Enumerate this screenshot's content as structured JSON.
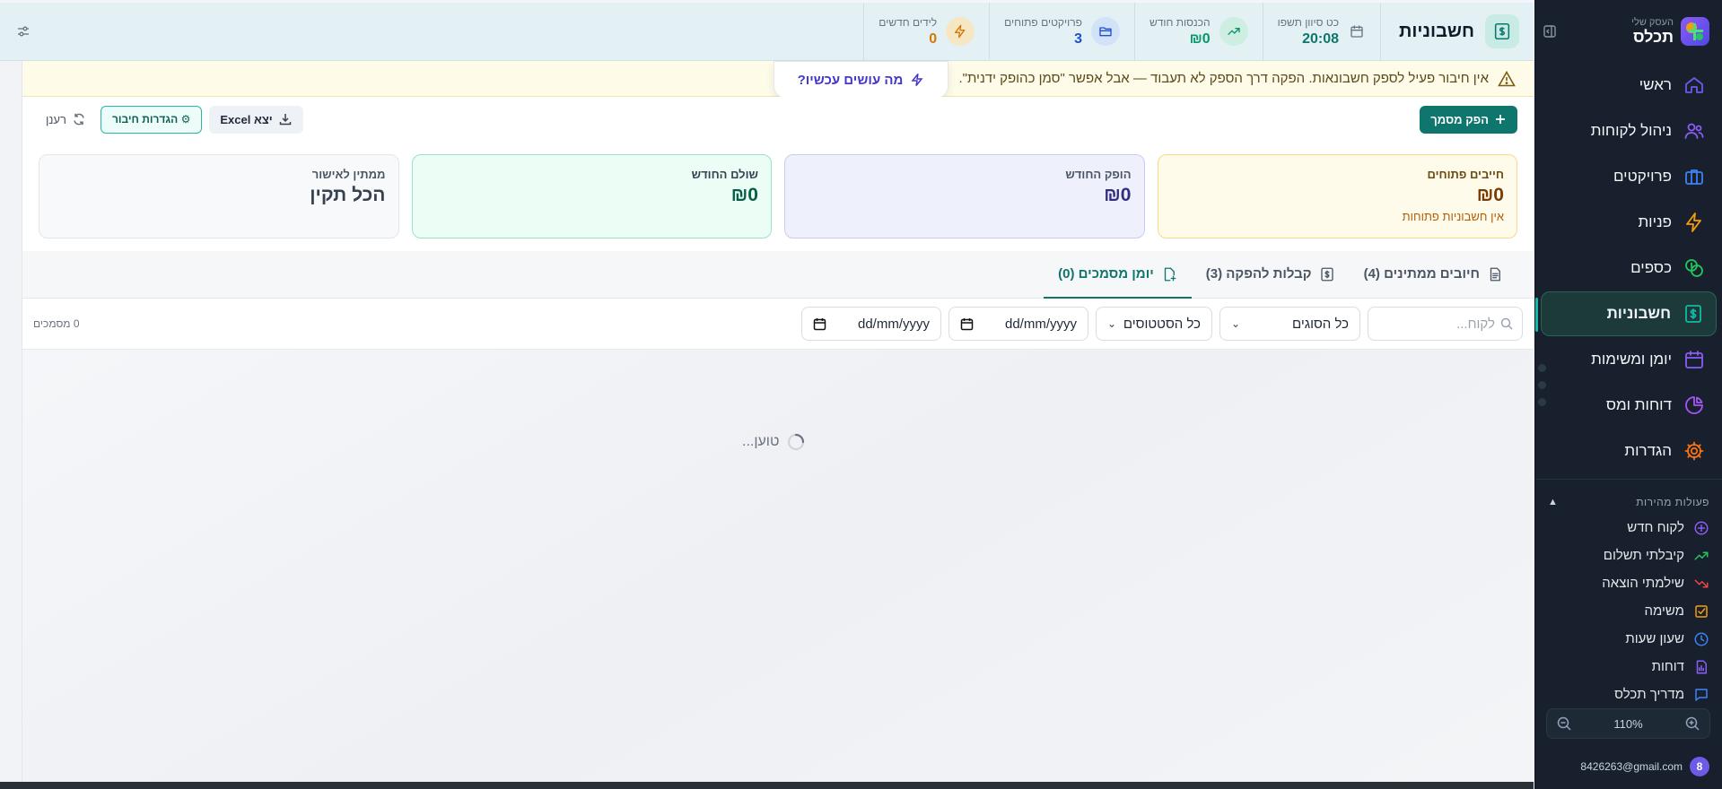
{
  "sidebar": {
    "brand_sub": "העסק שלי",
    "brand_name": "תכלס",
    "nav": [
      {
        "label": "ראשי",
        "icon": "home-icon",
        "color": "#6d5ae6"
      },
      {
        "label": "ניהול לקוחות",
        "icon": "users-icon",
        "color": "#8b5cf6"
      },
      {
        "label": "פרויקטים",
        "icon": "briefcase-icon",
        "color": "#3b82f6"
      },
      {
        "label": "פניות",
        "icon": "lightning-icon",
        "color": "#f59e0b"
      },
      {
        "label": "כספים",
        "icon": "coins-icon",
        "color": "#22c55e"
      },
      {
        "label": "חשבוניות",
        "icon": "invoice-icon",
        "color": "#14b8a6",
        "active": true
      },
      {
        "label": "יומן ומשימות",
        "icon": "calendar-icon",
        "color": "#8b5cf6"
      },
      {
        "label": "דוחות ומס",
        "icon": "pie-chart-icon",
        "color": "#a855f7"
      },
      {
        "label": "הגדרות",
        "icon": "gear-icon",
        "color": "#f97316"
      }
    ],
    "quick_title": "פעולות מהירות",
    "quick": [
      {
        "label": "לקוח חדש",
        "icon": "plus-circle-icon",
        "color": "#8b5cf6"
      },
      {
        "label": "קיבלתי תשלום",
        "icon": "trend-up-icon",
        "color": "#22c55e"
      },
      {
        "label": "שילמתי הוצאה",
        "icon": "trend-down-icon",
        "color": "#ef4444"
      },
      {
        "label": "משימה",
        "icon": "checkbox-icon",
        "color": "#f59e0b"
      },
      {
        "label": "שעון שעות",
        "icon": "clock-icon",
        "color": "#3b82f6"
      },
      {
        "label": "דוחות",
        "icon": "report-icon",
        "color": "#8b5cf6"
      },
      {
        "label": "מדריך תכלס",
        "icon": "chat-icon",
        "color": "#3b82f6"
      }
    ],
    "zoom": "110%",
    "user_initial": "8",
    "user_email": "8426263@gmail.com"
  },
  "topbar": {
    "title": "חשבוניות",
    "stats": [
      {
        "label": "כט סיוון תשפו",
        "value": "20:08",
        "color": "#0f766e",
        "icon": "calendar-icon",
        "plain": true
      },
      {
        "label": "הכנסות חודש",
        "value": "₪0",
        "color": "#059669",
        "icon": "trend-up-icon",
        "bg": "#cdeee0"
      },
      {
        "label": "פרויקטים פתוחים",
        "value": "3",
        "color": "#1d4ed8",
        "icon": "folder-icon",
        "bg": "#d3e3f7"
      },
      {
        "label": "לידים חדשים",
        "value": "0",
        "color": "#d97706",
        "icon": "lightning-icon",
        "bg": "#f5e6c4"
      }
    ]
  },
  "warning": {
    "text": "אין חיבור פעיל לספק חשבונאות. הפקה דרך הספק לא תעבוד — אבל אפשר \"סמן כהופק ידנית\".",
    "popup_label": "מה עושים עכשיו?"
  },
  "actions": {
    "issue_doc": "הפק מסמך",
    "export_excel": "יצא Excel",
    "connection_settings": "⚙ הגדרות חיבור",
    "refresh": "רענן"
  },
  "cards": [
    {
      "label": "חייבים פתוחים",
      "value": "₪0",
      "sub": "אין חשבוניות פתוחות",
      "style": "amber"
    },
    {
      "label": "הופק החודש",
      "value": "₪0",
      "sub": "",
      "style": "indigo"
    },
    {
      "label": "שולם החודש",
      "value": "₪0",
      "sub": "",
      "style": "green"
    },
    {
      "label": "ממתין לאישור",
      "value": "הכל תקין",
      "sub": "",
      "style": "gray"
    }
  ],
  "tabs": [
    {
      "label": "חיובים ממתינים (4)",
      "icon": "document-icon"
    },
    {
      "label": "קבלות להפקה (3)",
      "icon": "invoice-icon"
    },
    {
      "label": "יומן מסמכים (0)",
      "icon": "file-plus-icon",
      "active": true
    }
  ],
  "filters": {
    "search_placeholder": "לקוח...",
    "type_select": "כל הסוגים",
    "status_select": "כל הסטטוסים",
    "date_from": "dd/mm/yyyy",
    "date_to": "dd/mm/yyyy",
    "count": "0 מסמכים"
  },
  "loading_text": "טוען..."
}
